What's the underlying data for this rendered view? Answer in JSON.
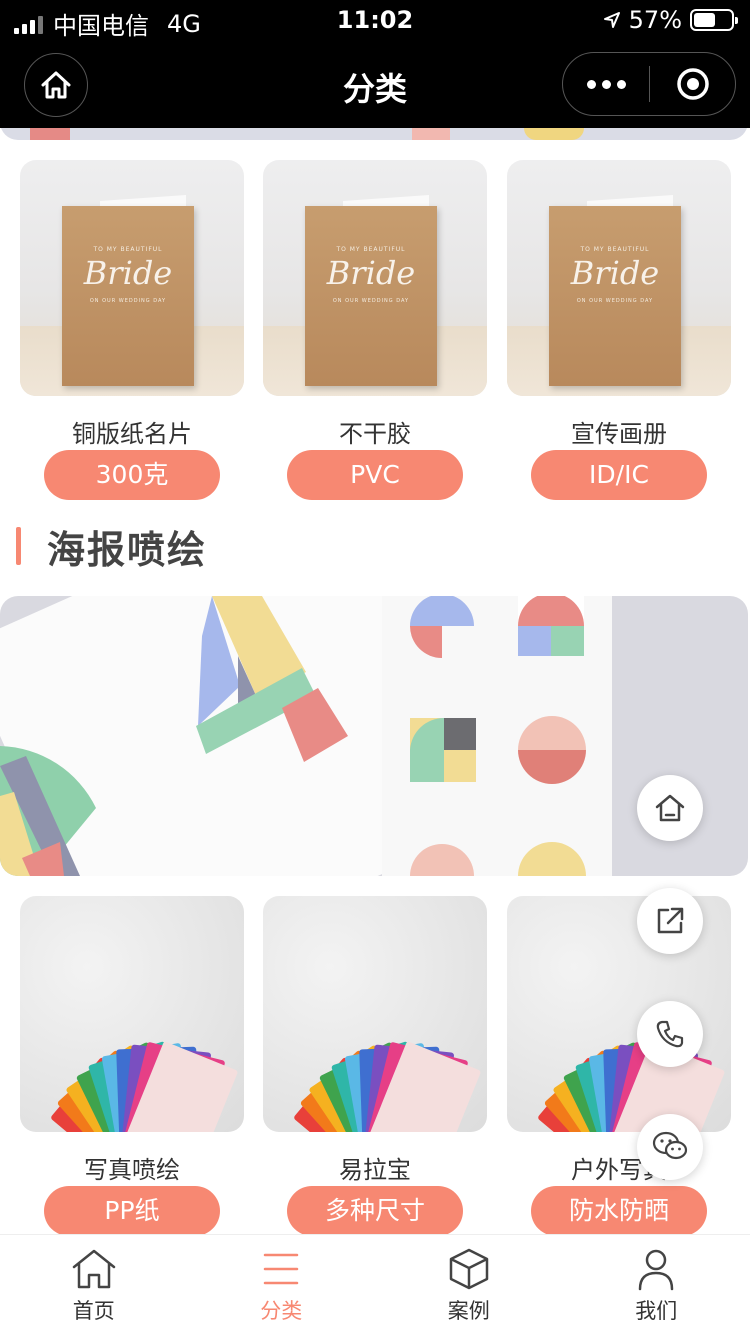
{
  "status": {
    "carrier": "中国电信",
    "network": "4G",
    "time": "11:02",
    "battery": "57%",
    "battery_level": 0.57
  },
  "nav": {
    "title": "分类"
  },
  "colors": {
    "accent": "#f78872"
  },
  "row1": [
    {
      "name": "铜版纸名片",
      "tag": "300克",
      "image_text": [
        "TO MY BEAUTIFUL",
        "Bride",
        "ON OUR WEDDING DAY"
      ]
    },
    {
      "name": "不干胶",
      "tag": "PVC",
      "image_text": [
        "TO MY BEAUTIFUL",
        "Bride",
        "ON OUR WEDDING DAY"
      ]
    },
    {
      "name": "宣传画册",
      "tag": "ID/IC",
      "image_text": [
        "TO MY BEAUTIFUL",
        "Bride",
        "ON OUR WEDDING DAY"
      ]
    }
  ],
  "section": {
    "title": "海报喷绘"
  },
  "row2": [
    {
      "name": "写真喷绘",
      "tag": "PP纸"
    },
    {
      "name": "易拉宝",
      "tag": "多种尺寸"
    },
    {
      "name": "户外写真",
      "tag": "防水防晒"
    }
  ],
  "fabs": [
    "home-icon",
    "share-icon",
    "phone-icon",
    "wechat-icon"
  ],
  "tabs": [
    {
      "label": "首页",
      "icon": "home-icon",
      "active": false
    },
    {
      "label": "分类",
      "icon": "menu-icon",
      "active": true
    },
    {
      "label": "案例",
      "icon": "cube-icon",
      "active": false
    },
    {
      "label": "我们",
      "icon": "user-icon",
      "active": false
    }
  ]
}
